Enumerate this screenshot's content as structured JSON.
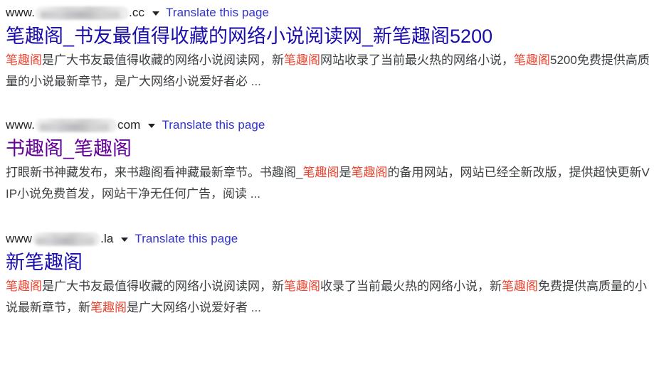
{
  "page": {
    "background": "#ffffff",
    "link_color": "#1a0dab",
    "visited_color": "#660099",
    "highlight_color": "#e8442f",
    "translate_color": "#3232cd",
    "body_text_color": "#3c4043"
  },
  "results": [
    {
      "url_prefix": "www.",
      "url_redacted": true,
      "url_suffix": ".cc",
      "translate_label": "Translate this page",
      "dropdown_icon": "chevron-down-icon",
      "title": "笔趣阁_书友最值得收藏的网络小说阅读网_新笔趣阁5200",
      "title_state": "unvisited",
      "snippet_parts": [
        {
          "text": "笔趣阁",
          "highlight": true
        },
        {
          "text": "是广大书友最值得收藏的网络小说阅读网，新",
          "highlight": false
        },
        {
          "text": "笔趣阁",
          "highlight": true
        },
        {
          "text": "网站收录了当前最火热的网络小说，",
          "highlight": false
        },
        {
          "text": "笔趣阁",
          "highlight": true
        },
        {
          "text": "5200免费提供高质量的小说最新章节，是广大网络小说爱好者必 ...",
          "highlight": false
        }
      ]
    },
    {
      "url_prefix": "www.",
      "url_redacted": true,
      "url_suffix": "com",
      "translate_label": "Translate this page",
      "dropdown_icon": "chevron-down-icon",
      "title": "书趣阁_笔趣阁",
      "title_state": "visited",
      "snippet_parts": [
        {
          "text": "打眼新书神藏发布，来书趣阁看神藏最新章节。书趣阁_",
          "highlight": false
        },
        {
          "text": "笔趣阁",
          "highlight": true
        },
        {
          "text": "是",
          "highlight": false
        },
        {
          "text": "笔趣阁",
          "highlight": true
        },
        {
          "text": "的备用网站，网站已经全新改版，提供超快更新VIP小说免费首发，网站干净无任何广告，阅读 ...",
          "highlight": false
        }
      ]
    },
    {
      "url_prefix": "www",
      "url_redacted": true,
      "url_suffix": ".la",
      "translate_label": "Translate this page",
      "dropdown_icon": "chevron-down-icon",
      "title": "新笔趣阁",
      "title_state": "unvisited",
      "snippet_parts": [
        {
          "text": "笔趣阁",
          "highlight": true
        },
        {
          "text": "是广大书友最值得收藏的网络小说阅读网，新",
          "highlight": false
        },
        {
          "text": "笔趣阁",
          "highlight": true
        },
        {
          "text": "收录了当前最火热的网络小说，新",
          "highlight": false
        },
        {
          "text": "笔趣阁",
          "highlight": true
        },
        {
          "text": "免费提供高质量的小说最新章节，新",
          "highlight": false
        },
        {
          "text": "笔趣阁",
          "highlight": true
        },
        {
          "text": "是广大网络小说爱好者 ...",
          "highlight": false
        }
      ]
    }
  ]
}
